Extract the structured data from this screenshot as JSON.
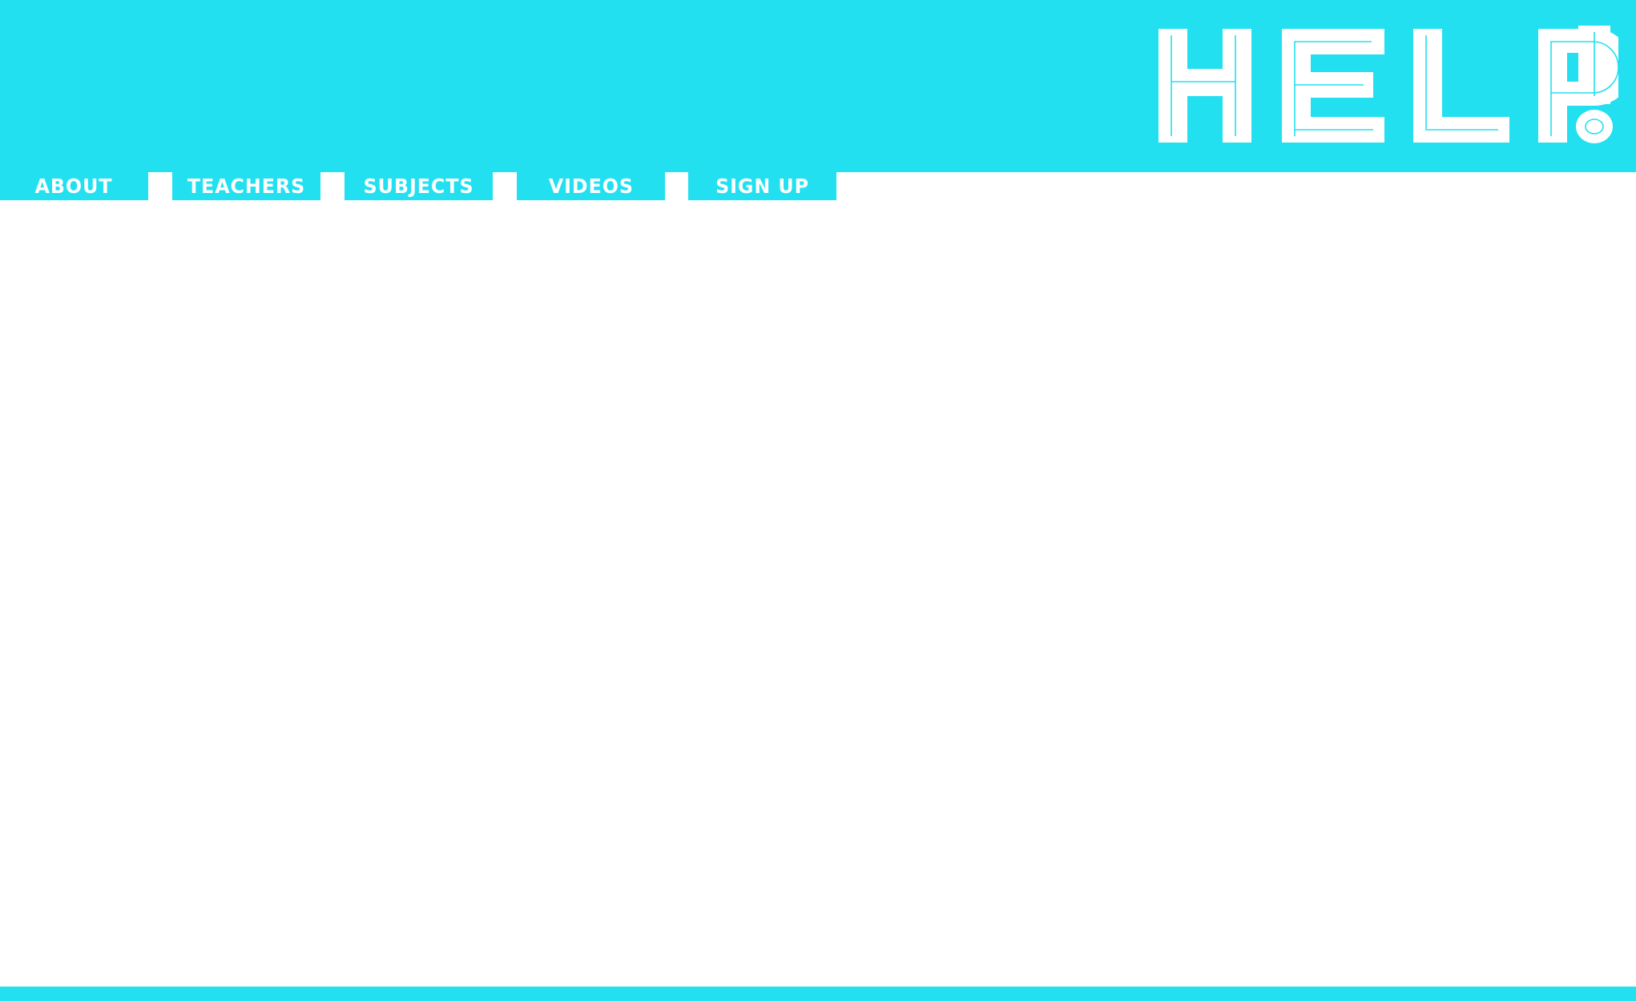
{
  "brand": {
    "logo_text": "HELP!",
    "accent_color": "#22e0f0",
    "background_color": "#ffffff"
  },
  "nav": {
    "items": [
      {
        "label": "ABOUT"
      },
      {
        "label": "TEACHERS"
      },
      {
        "label": "SUBJECTS"
      },
      {
        "label": "VIDEOS"
      },
      {
        "label": "SIGN UP"
      }
    ]
  }
}
